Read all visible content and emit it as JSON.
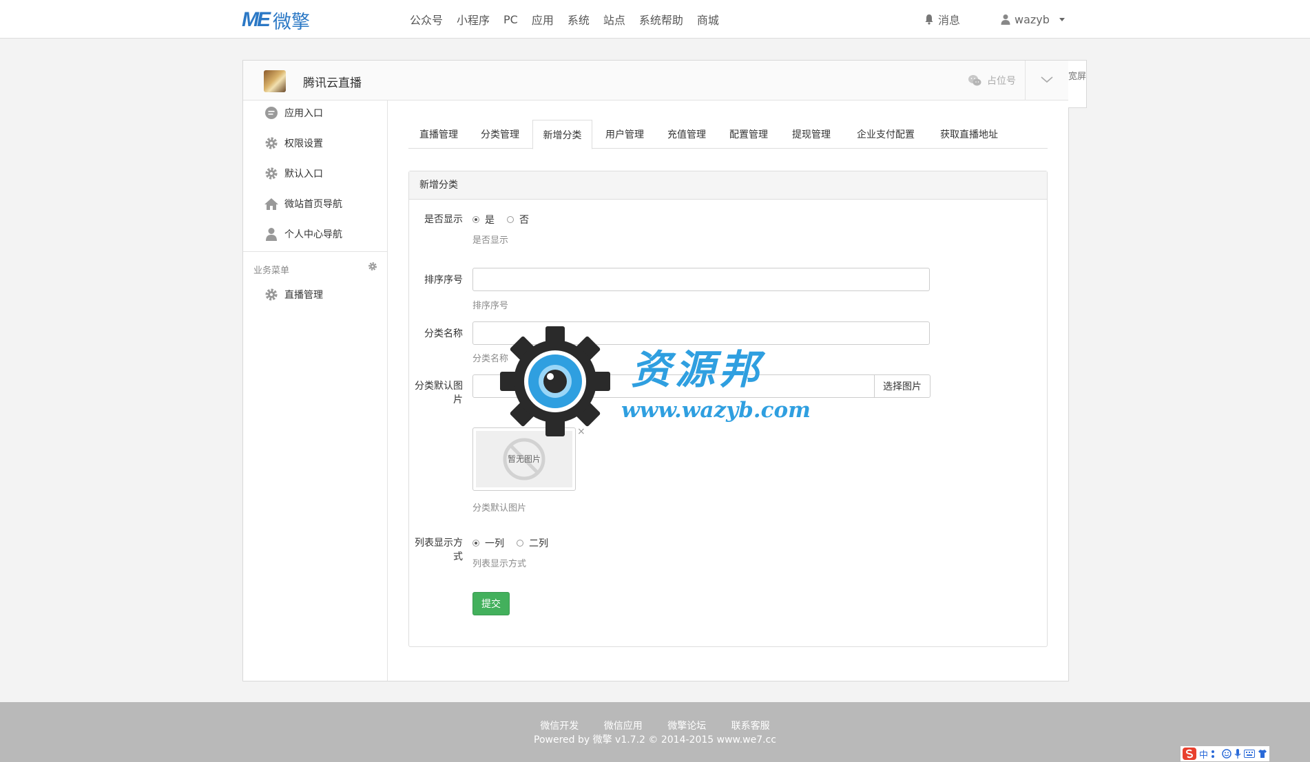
{
  "header": {
    "logo_mark": "ME",
    "logo_text": "微擎",
    "nav": [
      "公众号",
      "小程序",
      "PC",
      "应用",
      "系统",
      "站点",
      "系统帮助",
      "商城"
    ],
    "messages_label": "消息",
    "username": "wazyb"
  },
  "panel": {
    "app_title": "腾讯云直播",
    "placeholder_account": "占位号",
    "wide_label": "宽屏"
  },
  "sidebar": {
    "items": [
      "应用入口",
      "权限设置",
      "默认入口",
      "微站首页导航",
      "个人中心导航"
    ],
    "group_title": "业务菜单",
    "group_items": [
      "直播管理"
    ]
  },
  "tabs": [
    "直播管理",
    "分类管理",
    "新增分类",
    "用户管理",
    "充值管理",
    "配置管理",
    "提现管理",
    "企业支付配置",
    "获取直播地址"
  ],
  "active_tab": "新增分类",
  "form": {
    "title": "新增分类",
    "show_label": "是否显示",
    "show_yes": "是",
    "show_no": "否",
    "show_help": "是否显示",
    "sort_label": "排序序号",
    "sort_value": "",
    "sort_help": "排序序号",
    "name_label": "分类名称",
    "name_value": "",
    "name_help": "分类名称",
    "image_label": "分类默认图片",
    "image_value": "",
    "image_button": "选择图片",
    "image_placeholder": "暂无图片",
    "image_remove": "×",
    "image_help": "分类默认图片",
    "layout_label": "列表显示方式",
    "layout_opt1": "一列",
    "layout_opt2": "二列",
    "layout_help": "列表显示方式",
    "submit_label": "提交"
  },
  "watermark": {
    "title": "资源邦",
    "url": "www.wazyb.com"
  },
  "footer": {
    "links": [
      "微信开发",
      "微信应用",
      "微擎论坛",
      "联系客服"
    ],
    "copyright": "Powered by 微擎 v1.7.2 © 2014-2015 www.we7.cc"
  },
  "ime": {
    "lang": "中"
  },
  "colors": {
    "brand": "#2b78c5",
    "submit": "#43b05c",
    "watermark": "#2f9fe0"
  }
}
